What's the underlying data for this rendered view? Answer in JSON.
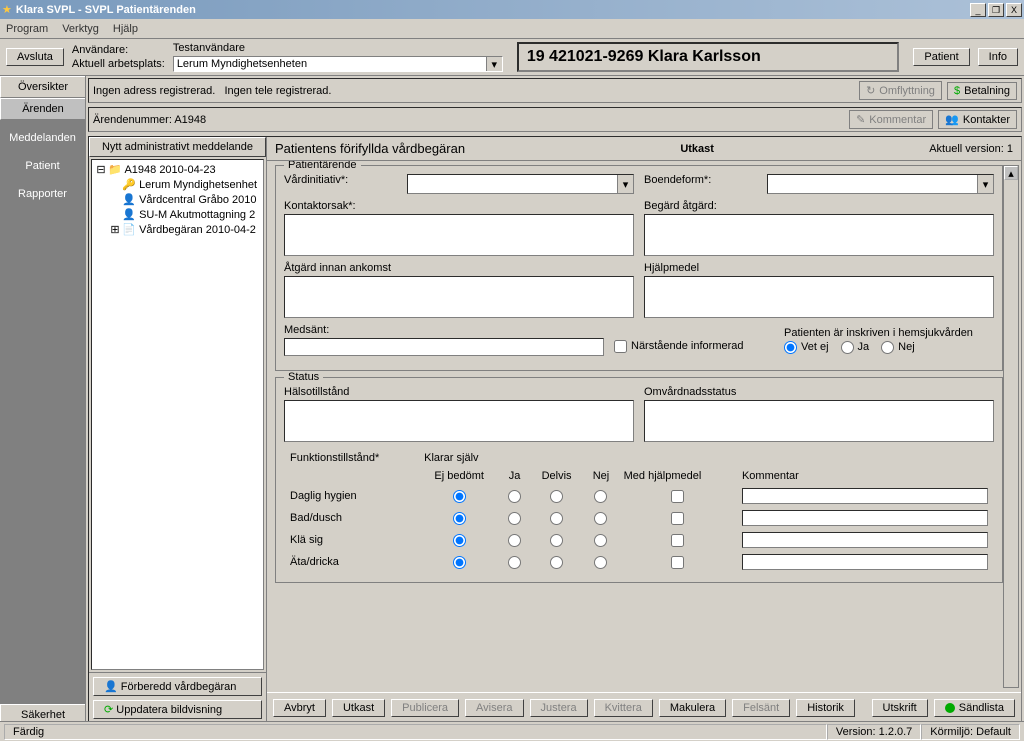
{
  "title": "Klara SVPL - SVPL Patientärenden",
  "menu": {
    "program": "Program",
    "verktyg": "Verktyg",
    "hjalp": "Hjälp"
  },
  "toolbar": {
    "avsluta": "Avsluta",
    "anvandare_lbl": "Användare:",
    "anvandare_val": "Testanvändare",
    "arbetsplats_lbl": "Aktuell arbetsplats:",
    "arbetsplats_val": "Lerum Myndighetsenheten",
    "patient": "Patient",
    "info": "Info"
  },
  "patient_id": "19 421021-9269 Klara Karlsson",
  "left_top_tabs": {
    "oversikter": "Översikter",
    "arenden": "Ärenden"
  },
  "dark_nav": {
    "meddelanden": "Meddelanden",
    "patient": "Patient",
    "rapporter": "Rapporter"
  },
  "sakerhet": "Säkerhet",
  "info_bar": {
    "adress": "Ingen adress registrerad.",
    "tele": "Ingen tele registrerad.",
    "arendenr_lbl": "Ärendenummer:",
    "arendenr_val": "A1948",
    "omflyttning": "Omflyttning",
    "betalning": "Betalning",
    "kommentar": "Kommentar",
    "kontakter": "Kontakter"
  },
  "tree": {
    "header": "Nytt administrativt meddelande",
    "root": "A1948 2010-04-23",
    "n1": "Lerum Myndighetsenhet",
    "n2": "Vårdcentral Gråbo 2010",
    "n3": "SU-M Akutmottagning 2",
    "n4": "Vårdbegäran 2010-04-2"
  },
  "form_header": {
    "title": "Patientens förifyllda vårdbegäran",
    "status": "Utkast",
    "version_lbl": "Aktuell version:",
    "version_val": "1"
  },
  "groups": {
    "patientarende": "Patientärende",
    "vardinitiativ": "Vårdinitiativ*:",
    "boendeform": "Boendeform*:",
    "kontaktorsak": "Kontaktorsak*:",
    "begard_atgard": "Begärd åtgärd:",
    "atgard_innan": "Åtgärd innan ankomst",
    "hjalpmedel": "Hjälpmedel",
    "medsant": "Medsänt:",
    "narstaende": "Närstående informerad",
    "inskriven_lbl": "Patienten är inskriven i hemsjukvården",
    "vet_ej": "Vet ej",
    "ja": "Ja",
    "nej": "Nej",
    "status": "Status",
    "halsotillstand": "Hälsotillstånd",
    "omvardnad": "Omvårdnadsstatus",
    "funktion": "Funktionstillstånd*",
    "klarar": "Klarar själv",
    "col_ejbedomt": "Ej bedömt",
    "col_ja": "Ja",
    "col_delvis": "Delvis",
    "col_nej": "Nej",
    "col_hjalpmedel": "Med hjälpmedel",
    "col_kommentar": "Kommentar",
    "rows": [
      "Daglig hygien",
      "Bad/dusch",
      "Klä sig",
      "Äta/dricka"
    ]
  },
  "bottom": {
    "forberedd": "Förberedd vårdbegäran",
    "uppdatera": "Uppdatera bildvisning",
    "avbryt": "Avbryt",
    "utkast": "Utkast",
    "publicera": "Publicera",
    "avisera": "Avisera",
    "justera": "Justera",
    "kvittera": "Kvittera",
    "makulera": "Makulera",
    "felsant": "Felsänt",
    "historik": "Historik",
    "utskrift": "Utskrift",
    "sandlista": "Sändlista"
  },
  "status": {
    "ready": "Färdig",
    "version": "Version: 1.2.0.7",
    "env": "Körmiljö: Default"
  }
}
